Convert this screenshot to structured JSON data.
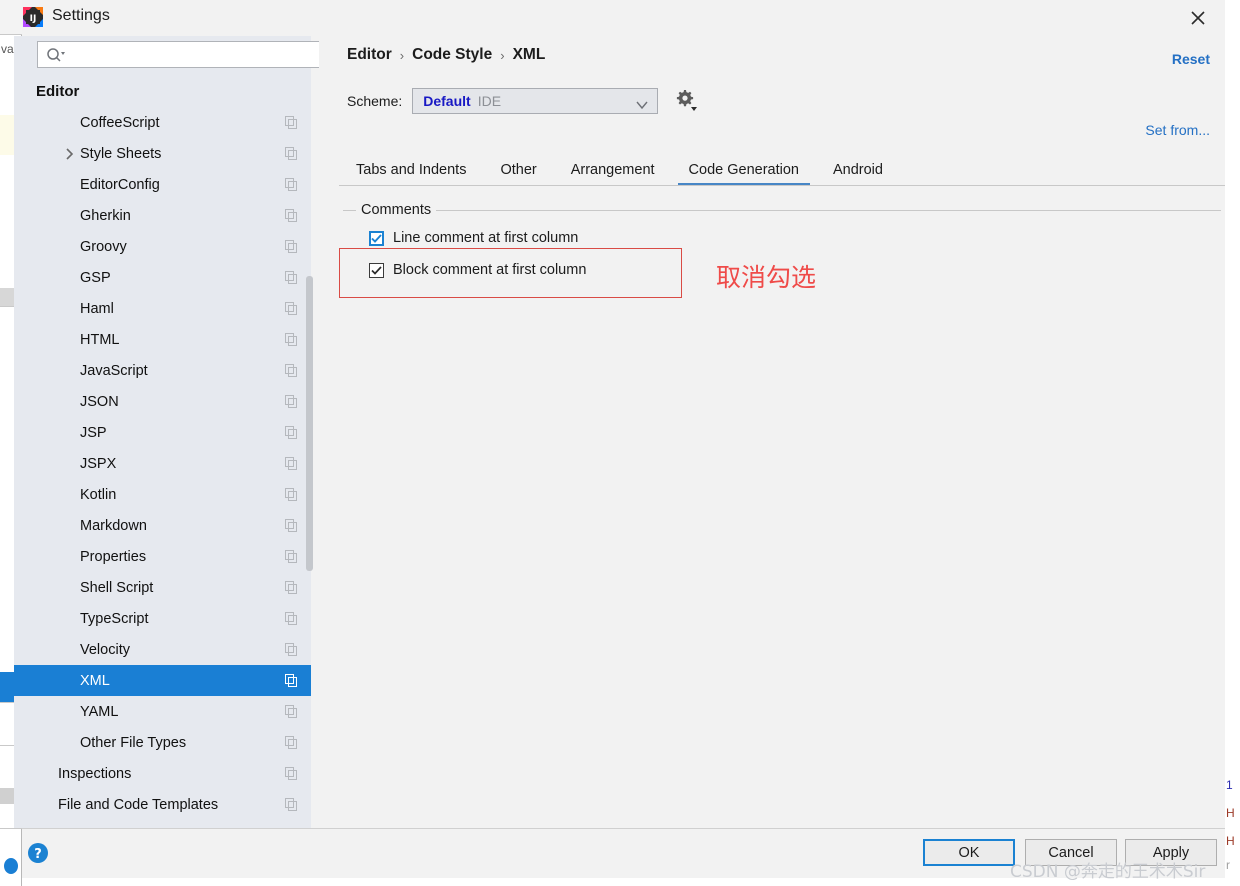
{
  "window": {
    "title": "Settings",
    "app_icon": "intellij-idea-icon",
    "close_icon": "close-icon"
  },
  "search": {
    "value": "",
    "placeholder": "",
    "icon": "search-icon"
  },
  "sidebar": {
    "scroll_position": "middle",
    "items": [
      {
        "label": "Editor",
        "indent": 0,
        "bold": true,
        "chevron": false,
        "copy_icon": false,
        "selected": false
      },
      {
        "label": "CoffeeScript",
        "indent": 2,
        "bold": false,
        "chevron": false,
        "copy_icon": true,
        "selected": false
      },
      {
        "label": "Style Sheets",
        "indent": 2,
        "bold": false,
        "chevron": true,
        "copy_icon": true,
        "selected": false
      },
      {
        "label": "EditorConfig",
        "indent": 2,
        "bold": false,
        "chevron": false,
        "copy_icon": true,
        "selected": false
      },
      {
        "label": "Gherkin",
        "indent": 2,
        "bold": false,
        "chevron": false,
        "copy_icon": true,
        "selected": false
      },
      {
        "label": "Groovy",
        "indent": 2,
        "bold": false,
        "chevron": false,
        "copy_icon": true,
        "selected": false
      },
      {
        "label": "GSP",
        "indent": 2,
        "bold": false,
        "chevron": false,
        "copy_icon": true,
        "selected": false
      },
      {
        "label": "Haml",
        "indent": 2,
        "bold": false,
        "chevron": false,
        "copy_icon": true,
        "selected": false
      },
      {
        "label": "HTML",
        "indent": 2,
        "bold": false,
        "chevron": false,
        "copy_icon": true,
        "selected": false
      },
      {
        "label": "JavaScript",
        "indent": 2,
        "bold": false,
        "chevron": false,
        "copy_icon": true,
        "selected": false
      },
      {
        "label": "JSON",
        "indent": 2,
        "bold": false,
        "chevron": false,
        "copy_icon": true,
        "selected": false
      },
      {
        "label": "JSP",
        "indent": 2,
        "bold": false,
        "chevron": false,
        "copy_icon": true,
        "selected": false
      },
      {
        "label": "JSPX",
        "indent": 2,
        "bold": false,
        "chevron": false,
        "copy_icon": true,
        "selected": false
      },
      {
        "label": "Kotlin",
        "indent": 2,
        "bold": false,
        "chevron": false,
        "copy_icon": true,
        "selected": false
      },
      {
        "label": "Markdown",
        "indent": 2,
        "bold": false,
        "chevron": false,
        "copy_icon": true,
        "selected": false
      },
      {
        "label": "Properties",
        "indent": 2,
        "bold": false,
        "chevron": false,
        "copy_icon": true,
        "selected": false
      },
      {
        "label": "Shell Script",
        "indent": 2,
        "bold": false,
        "chevron": false,
        "copy_icon": true,
        "selected": false
      },
      {
        "label": "TypeScript",
        "indent": 2,
        "bold": false,
        "chevron": false,
        "copy_icon": true,
        "selected": false
      },
      {
        "label": "Velocity",
        "indent": 2,
        "bold": false,
        "chevron": false,
        "copy_icon": true,
        "selected": false
      },
      {
        "label": "XML",
        "indent": 2,
        "bold": false,
        "chevron": false,
        "copy_icon": true,
        "selected": true
      },
      {
        "label": "YAML",
        "indent": 2,
        "bold": false,
        "chevron": false,
        "copy_icon": true,
        "selected": false
      },
      {
        "label": "Other File Types",
        "indent": 2,
        "bold": false,
        "chevron": false,
        "copy_icon": true,
        "selected": false
      },
      {
        "label": "Inspections",
        "indent": 1,
        "bold": false,
        "chevron": false,
        "copy_icon": true,
        "selected": false
      },
      {
        "label": "File and Code Templates",
        "indent": 1,
        "bold": false,
        "chevron": false,
        "copy_icon": true,
        "selected": false
      }
    ]
  },
  "breadcrumb": {
    "separator": "›",
    "crumbs": [
      "Editor",
      "Code Style",
      "XML"
    ]
  },
  "links": {
    "reset": "Reset",
    "set_from": "Set from..."
  },
  "scheme": {
    "label": "Scheme:",
    "value": "Default",
    "suffix": "IDE",
    "arrow_icon": "chevron-down-icon",
    "gear_icon": "gear-icon"
  },
  "tabs": [
    {
      "label": "Tabs and Indents",
      "active": false
    },
    {
      "label": "Other",
      "active": false
    },
    {
      "label": "Arrangement",
      "active": false
    },
    {
      "label": "Code Generation",
      "active": true
    },
    {
      "label": "Android",
      "active": false
    }
  ],
  "content": {
    "group_title": "Comments",
    "checkboxes": [
      {
        "label": "Line comment at first column",
        "checked": true,
        "focused": true
      },
      {
        "label": "Block comment at first column",
        "checked": true,
        "focused": false
      }
    ]
  },
  "annotation": {
    "text": "取消勾选",
    "color": "#ef4b49",
    "box_color": "#d94b45"
  },
  "buttons": {
    "help_icon": "help-icon",
    "ok": "OK",
    "cancel": "Cancel",
    "apply": "Apply"
  },
  "watermark": "CSDN @奔走的王术木Sir",
  "background": {
    "left_text": "va",
    "right_texts": [
      "1",
      "H",
      "H",
      "r"
    ]
  },
  "colors": {
    "accent_blue": "#1a7fd4",
    "link_blue": "#2470c4",
    "scheme_value_blue": "#1818c4",
    "tab_underline": "#4786c6",
    "dialog_bg": "#f2f2f2",
    "sidebar_bg": "#e6e9ef"
  }
}
